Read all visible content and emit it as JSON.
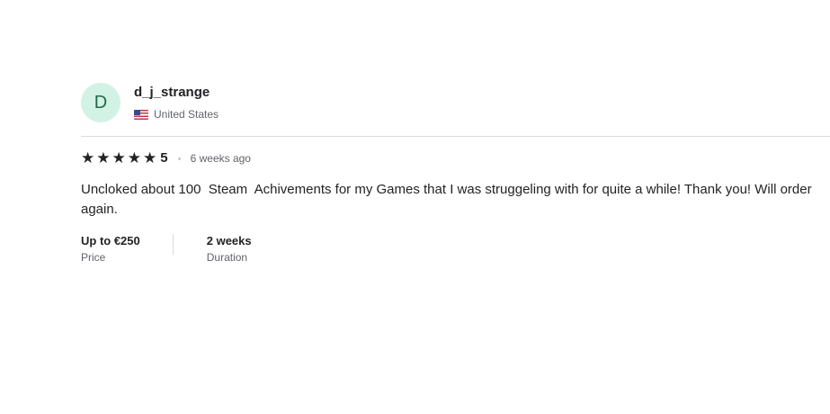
{
  "reviewer": {
    "avatar_letter": "D",
    "username": "d_j_strange",
    "country": "United States",
    "flag_icon": "us-flag-icon"
  },
  "review": {
    "rating": "5",
    "stars": 5,
    "time_ago": "6 weeks ago",
    "text": "Uncloked about 100  Steam  Achivements for my Games that I was struggeling with for quite a while! Thank you! Will order again."
  },
  "meta": {
    "price_value": "Up to €250",
    "price_label": "Price",
    "duration_value": "2 weeks",
    "duration_label": "Duration"
  },
  "colors": {
    "avatar_bg": "#d3f2e6",
    "text": "#222325",
    "muted": "#62646a"
  }
}
